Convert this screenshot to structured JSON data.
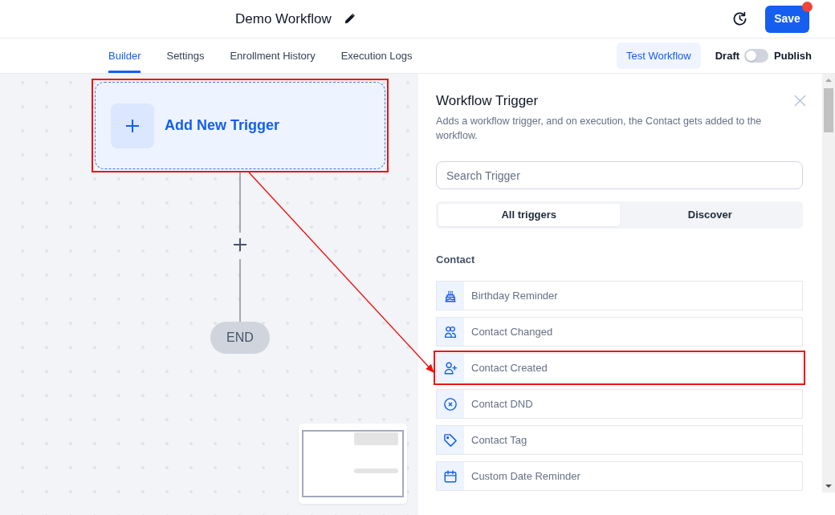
{
  "header": {
    "title": "Demo Workflow",
    "save_button": "Save",
    "unsaved_changes": true
  },
  "tabs": [
    {
      "label": "Builder",
      "selected": true
    },
    {
      "label": "Settings",
      "selected": false
    },
    {
      "label": "Enrollment History",
      "selected": false
    },
    {
      "label": "Execution Logs",
      "selected": false
    }
  ],
  "test_button": "Test Workflow",
  "status_toggle": {
    "off_label": "Draft",
    "on_label": "Publish",
    "on": false
  },
  "canvas": {
    "trigger_node": {
      "label": "Add New Trigger",
      "highlighted": true
    },
    "end_node": "END"
  },
  "panel": {
    "title": "Workflow Trigger",
    "description": "Adds a workflow trigger, and on execution, the Contact gets added to the workflow.",
    "search": {
      "placeholder": "Search Trigger"
    },
    "filters": [
      {
        "label": "All triggers",
        "selected": true
      },
      {
        "label": "Discover",
        "selected": false
      }
    ],
    "section": "Contact",
    "triggers": [
      {
        "label": "Birthday Reminder",
        "kind": "birthday",
        "highlighted": false
      },
      {
        "label": "Contact Changed",
        "kind": "changed",
        "highlighted": false
      },
      {
        "label": "Contact Created",
        "kind": "created",
        "highlighted": true
      },
      {
        "label": "Contact DND",
        "kind": "dnd",
        "highlighted": false
      },
      {
        "label": "Contact Tag",
        "kind": "tag",
        "highlighted": false
      },
      {
        "label": "Custom Date Reminder",
        "kind": "date",
        "highlighted": false
      }
    ]
  }
}
